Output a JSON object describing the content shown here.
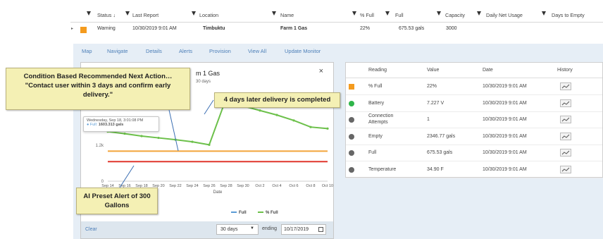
{
  "grid": {
    "headers": [
      "Status ↓",
      "Last Report",
      "Location",
      "Name",
      "% Full",
      "Full",
      "Capacity",
      "Daily Net Usage",
      "Days to Empty"
    ],
    "row": {
      "status": "Warning",
      "last_report": "10/30/2019 9:01 AM",
      "location": "Timbuktu",
      "name": "Farm 1 Gas",
      "pct_full": "22%",
      "full": "675.53 gals",
      "capacity": "3000"
    }
  },
  "tabs": [
    "Map",
    "Navigate",
    "Details",
    "Alerts",
    "Provision",
    "View All",
    "Update Monitor"
  ],
  "dialog": {
    "title": "m 1 Gas",
    "subtitle": "30 days",
    "close": "×",
    "clear_label": "Clear",
    "range_value": "30 days",
    "ending_label": "ending",
    "ending_value": "10/17/2019"
  },
  "tooltip": {
    "date": "Wednesday, Sep 18, 3:01:08 PM",
    "series": "● Full:",
    "value": "1603.313 gals"
  },
  "callouts": {
    "condition": "Condition Based Recommended Next Action… \"Contact user within 3 days and confirm early delivery.\"",
    "delivery": "4 days later delivery is completed",
    "alert": "AI Preset Alert of 300 Gallons"
  },
  "reading_table": {
    "headers": [
      "Reading",
      "Value",
      "Date",
      "History"
    ],
    "rows": [
      {
        "reading": "% Full",
        "value": "22%",
        "date": "10/30/2019 9:01 AM",
        "marker": "square",
        "color": "#f49b1e"
      },
      {
        "reading": "Battery",
        "value": "7.227 V",
        "date": "10/30/2019 9:01 AM",
        "marker": "circle",
        "color": "#2fb54a"
      },
      {
        "reading": "Connection Attempts",
        "value": "1",
        "date": "10/30/2019 9:01 AM",
        "marker": "circle",
        "color": "#666666"
      },
      {
        "reading": "Empty",
        "value": "2346.77 gals",
        "date": "10/30/2019 9:01 AM",
        "marker": "circle",
        "color": "#666666"
      },
      {
        "reading": "Full",
        "value": "675.53 gals",
        "date": "10/30/2019 9:01 AM",
        "marker": "circle",
        "color": "#666666"
      },
      {
        "reading": "Temperature",
        "value": "34.90 F",
        "date": "10/30/2019 9:01 AM",
        "marker": "circle",
        "color": "#666666"
      }
    ]
  },
  "chart_data": {
    "type": "line",
    "x": [
      "Sep 14",
      "Sep 16",
      "Sep 18",
      "Sep 20",
      "Sep 22",
      "Sep 24",
      "Sep 26",
      "Sep 28",
      "Sep 30",
      "Oct 2",
      "Oct 4",
      "Oct 6",
      "Oct 8",
      "Oct 10"
    ],
    "xlabel": "Date",
    "ytick_label": "1.2k",
    "ytick_zero": "0",
    "series": [
      {
        "name": "Full",
        "color": "#5b9bd5",
        "values": [
          null,
          null,
          null,
          null,
          null,
          null,
          null,
          null,
          null,
          null,
          null,
          null,
          null,
          null
        ]
      },
      {
        "name": "% Full",
        "color": "#6cc04a",
        "values": [
          1650,
          1580,
          1500,
          1440,
          1380,
          1310,
          1210,
          2750,
          2500,
          2350,
          2200,
          2020,
          1800,
          1750
        ]
      }
    ],
    "alert_lines": [
      {
        "value": 1000,
        "color": "#f3a53a"
      },
      {
        "value": 650,
        "color": "#e0362d"
      }
    ],
    "ylim": [
      0,
      3000
    ]
  }
}
